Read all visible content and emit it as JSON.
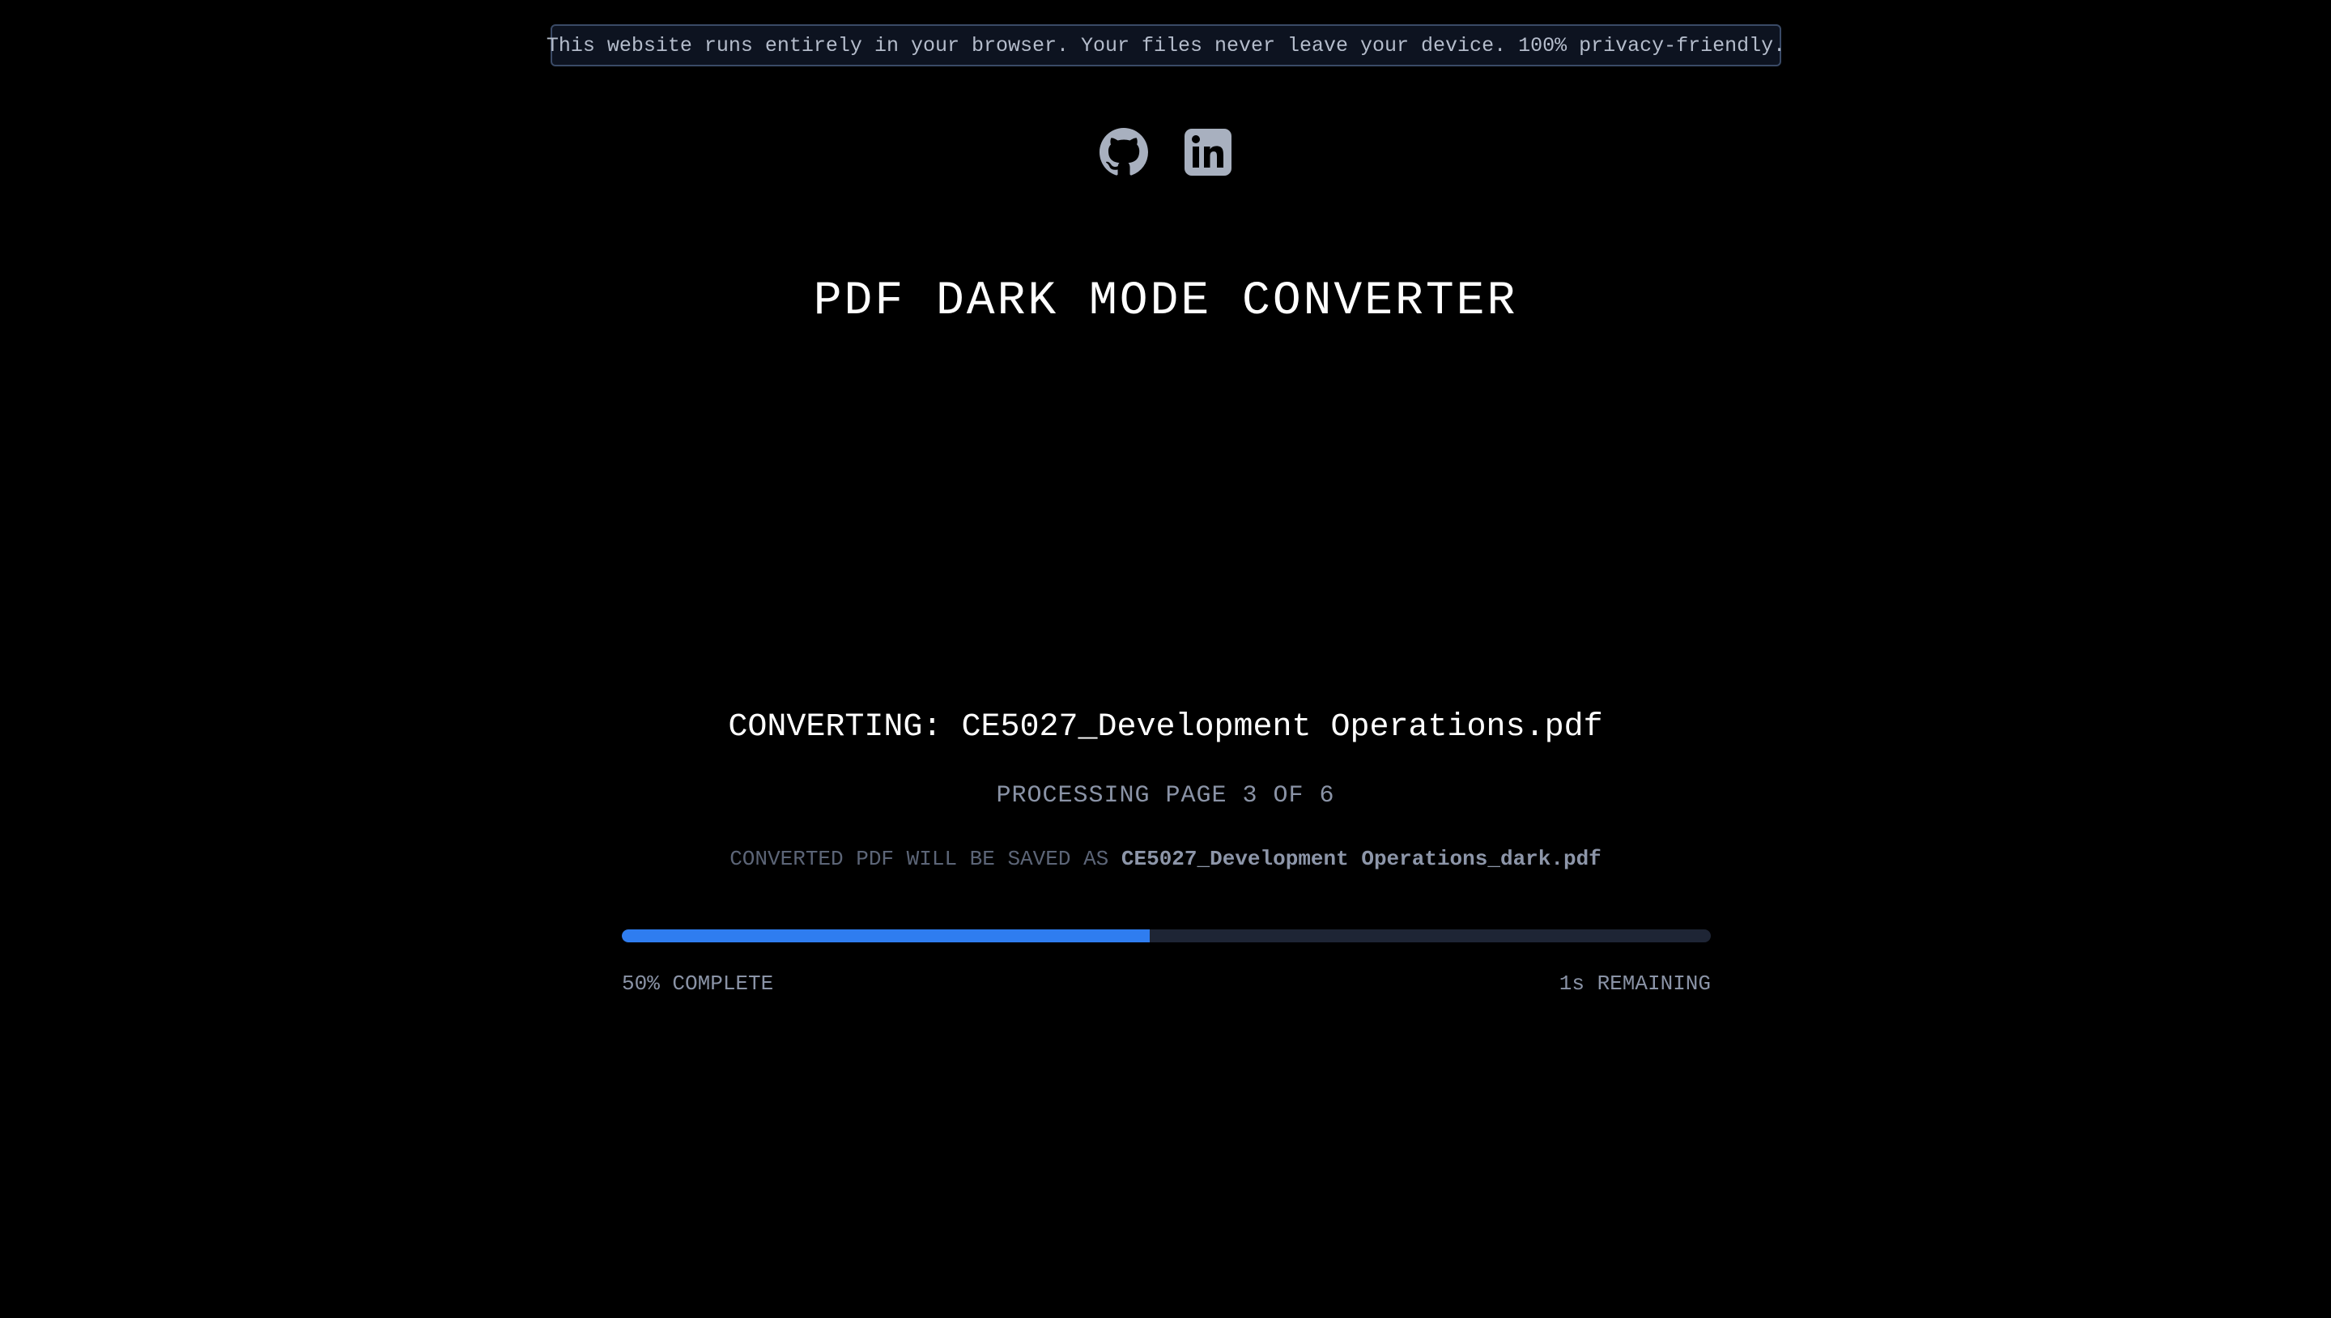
{
  "banner": {
    "text": "This website runs entirely in your browser. Your files never leave your device. 100% privacy-friendly."
  },
  "social": [
    {
      "icon": "github-icon"
    },
    {
      "icon": "linkedin-icon"
    }
  ],
  "title": "PDF DARK MODE CONVERTER",
  "status": {
    "converting_label": "CONVERTING:",
    "filename": "CE5027_Development Operations.pdf",
    "processing": "PROCESSING PAGE 3 OF 6",
    "saved_as_label": "CONVERTED PDF WILL BE SAVED AS",
    "output_filename": "CE5027_Development Operations_dark.pdf"
  },
  "progress": {
    "percent": 48.5,
    "complete_text": "50% COMPLETE",
    "remaining_text": "1s REMAINING"
  },
  "colors": {
    "background": "#000000",
    "accent": "#2f7df0",
    "track": "#1e2535",
    "icon": "#a8b0bf"
  }
}
